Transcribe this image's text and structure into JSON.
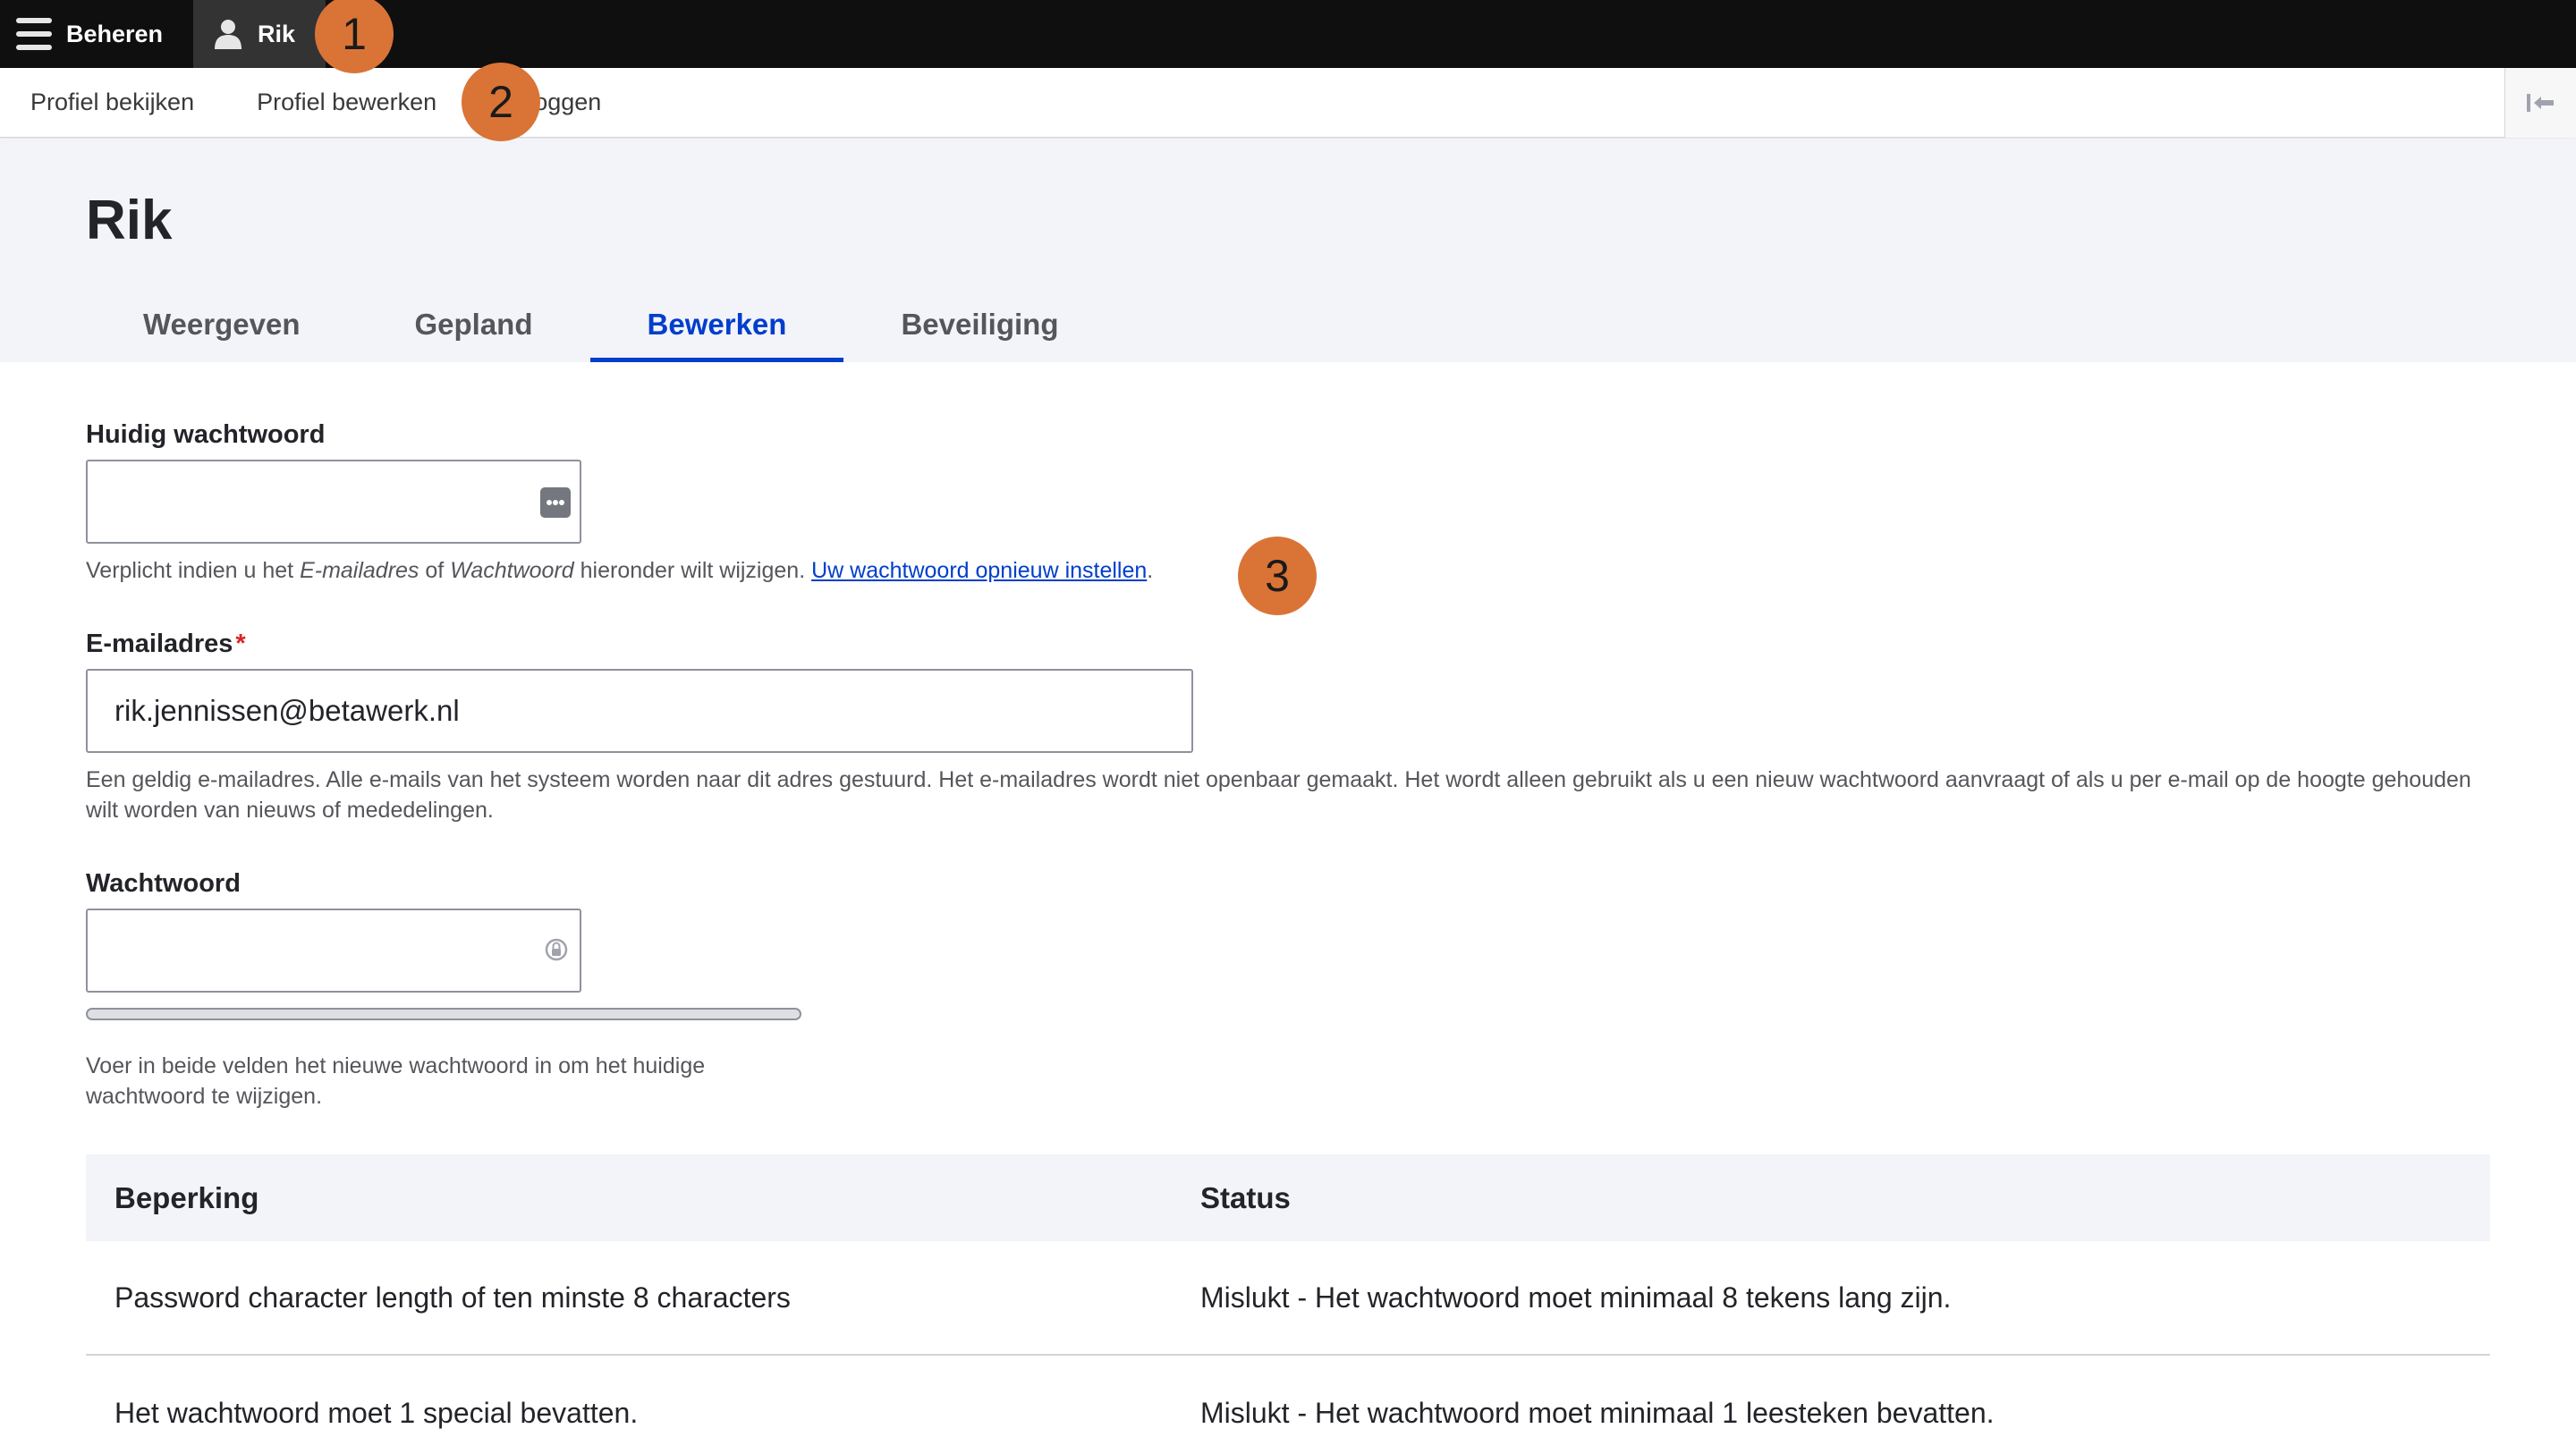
{
  "toolbar": {
    "manage_label": "Beheren",
    "user_label": "Rik"
  },
  "tray": {
    "links": [
      "Profiel bekijken",
      "Profiel bewerken",
      "Uitloggen"
    ]
  },
  "page": {
    "title": "Rik",
    "tabs": [
      "Weergeven",
      "Gepland",
      "Bewerken",
      "Beveiliging"
    ],
    "active_tab": "Bewerken"
  },
  "form": {
    "current_password": {
      "label": "Huidig wachtwoord",
      "value": "",
      "desc_part1": "Verplicht indien u het ",
      "desc_em1": "E-mailadres",
      "desc_part2": " of ",
      "desc_em2": "Wachtwoord",
      "desc_part3": " hieronder wilt wijzigen. ",
      "reset_link": "Uw wachtwoord opnieuw instellen",
      "desc_end": "."
    },
    "email": {
      "label": "E-mailadres",
      "required_mark": "*",
      "value": "rik.jennissen@betawerk.nl",
      "description": "Een geldig e-mailadres. Alle e-mails van het systeem worden naar dit adres gestuurd. Het e-mailadres wordt niet openbaar gemaakt. Het wordt alleen gebruikt als u een nieuw wachtwoord aanvraagt of als u per e-mail op de hoogte gehouden wilt worden van nieuws of mededelingen."
    },
    "password": {
      "label": "Wachtwoord",
      "value": "",
      "strength": 0,
      "description": "Voer in beide velden het nieuwe wachtwoord in om het huidige wachtwoord te wijzigen."
    }
  },
  "constraints": {
    "headers": [
      "Beperking",
      "Status"
    ],
    "rows": [
      [
        "Password character length of ten minste 8 characters",
        "Mislukt - Het wachtwoord moet minimaal 8 tekens lang zijn."
      ],
      [
        "Het wachtwoord moet 1 special bevatten.",
        "Mislukt - Het wachtwoord moet minimaal 1 leesteken bevatten."
      ]
    ]
  },
  "annotations": [
    "1",
    "2",
    "3"
  ],
  "colors": {
    "toolbar_bg": "#0f0f0f",
    "accent": "#003ecc",
    "badge": "#d97436",
    "required": "#dc2323"
  }
}
